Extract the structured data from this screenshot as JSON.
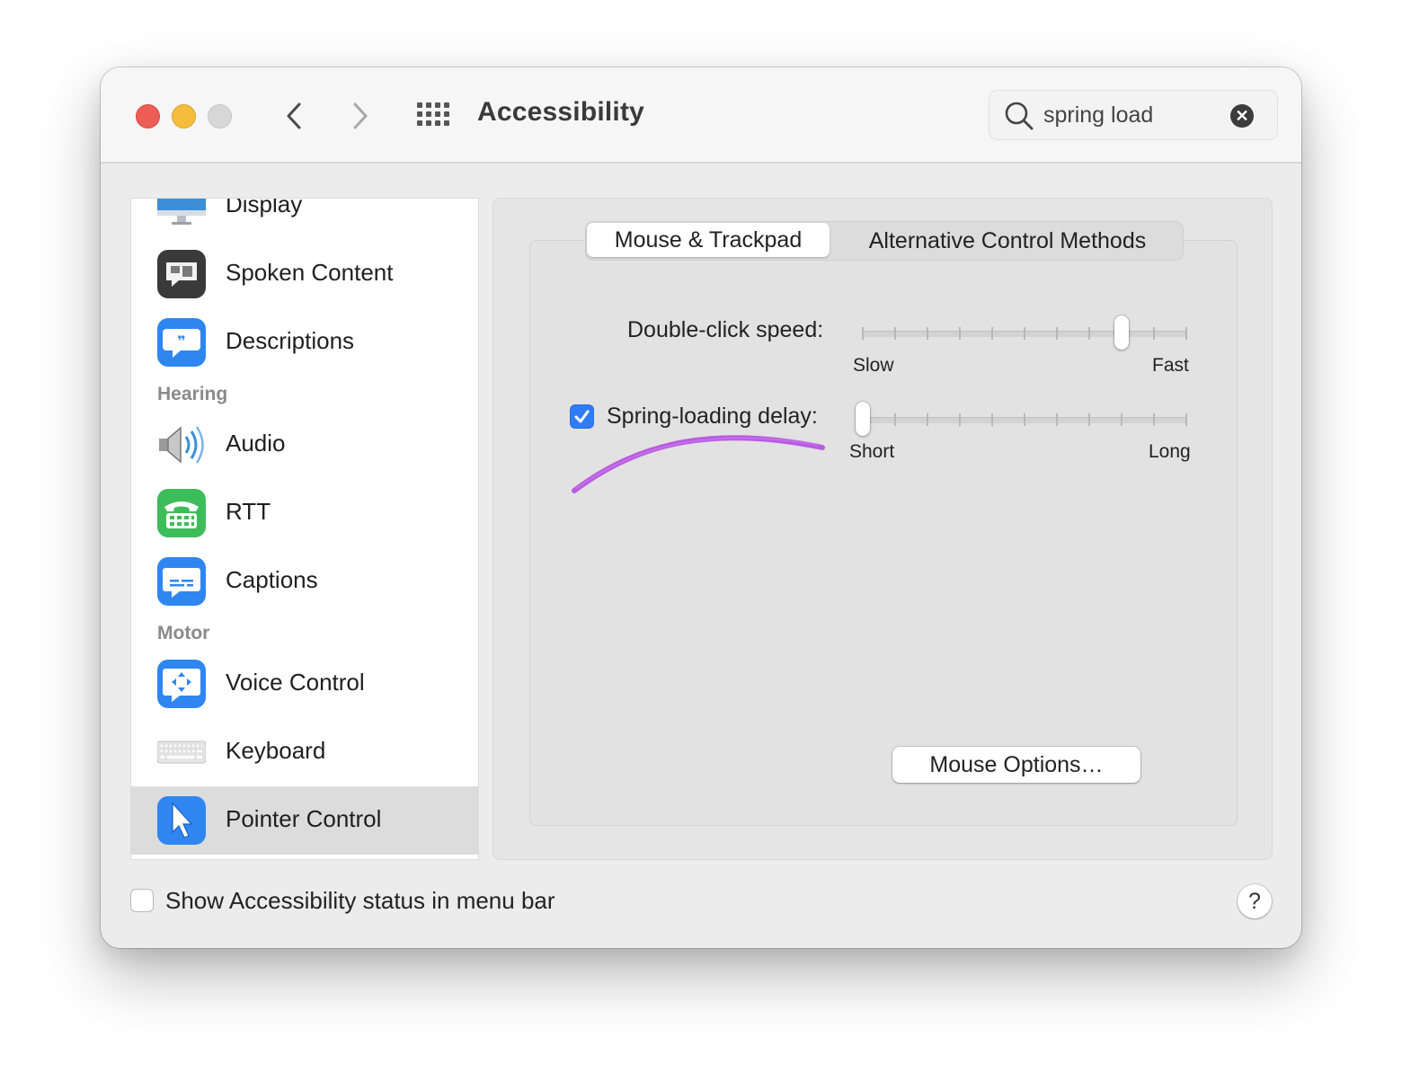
{
  "window": {
    "title": "Accessibility",
    "search": {
      "value": "spring load",
      "placeholder": "Search"
    }
  },
  "sidebar": {
    "items": [
      {
        "label": "Display",
        "icon": "display-icon"
      },
      {
        "label": "Spoken Content",
        "icon": "spoken-content-icon"
      },
      {
        "label": "Descriptions",
        "icon": "descriptions-icon"
      },
      {
        "label": "Audio",
        "icon": "speaker-icon"
      },
      {
        "label": "RTT",
        "icon": "rtt-phone-icon"
      },
      {
        "label": "Captions",
        "icon": "captions-icon"
      },
      {
        "label": "Voice Control",
        "icon": "voice-control-icon"
      },
      {
        "label": "Keyboard",
        "icon": "keyboard-icon"
      },
      {
        "label": "Pointer Control",
        "icon": "pointer-icon",
        "selected": true
      }
    ],
    "sections": {
      "hearing": "Hearing",
      "motor": "Motor"
    }
  },
  "tabs": [
    {
      "label": "Mouse & Trackpad",
      "active": true
    },
    {
      "label": "Alternative Control Methods",
      "active": false
    }
  ],
  "settings": {
    "double_click": {
      "label": "Double-click speed:",
      "min_label": "Slow",
      "max_label": "Fast",
      "ticks": 11,
      "position_index": 8
    },
    "spring_loading": {
      "label": "Spring-loading delay:",
      "checked": true,
      "min_label": "Short",
      "max_label": "Long",
      "ticks": 11,
      "position_index": 0
    },
    "mouse_options_button": "Mouse Options…"
  },
  "footer": {
    "status_checkbox_label": "Show Accessibility status in menu bar",
    "status_checked": false,
    "help_label": "?"
  },
  "colors": {
    "accent": "#2f7cf6",
    "annotation": "#b44fe0",
    "close": "#ee5d55",
    "minimize": "#f4bd3e"
  }
}
